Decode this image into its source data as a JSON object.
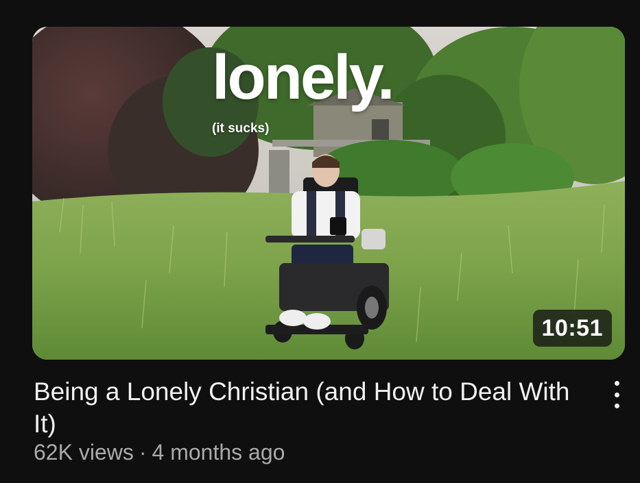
{
  "video": {
    "thumbnail": {
      "overlay_title": "lonely.",
      "overlay_subtitle": "(it sucks)",
      "duration": "10:51"
    },
    "title": "Being a Lonely Christian (and How to Deal With It)",
    "views": "62K views",
    "separator": "·",
    "age": "4 months ago",
    "menu_icon": "more-vertical-icon"
  },
  "colors": {
    "background": "#0f0f0f",
    "title_text": "#f1f1f1",
    "meta_text": "#aaaaaa"
  }
}
